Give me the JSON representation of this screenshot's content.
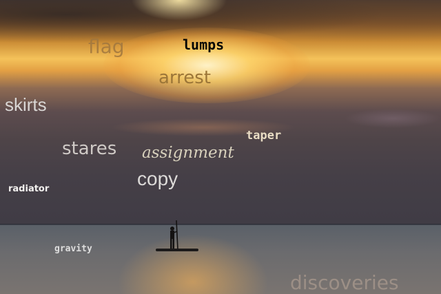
{
  "overlay_words": {
    "flag": "flag",
    "lumps": "lumps",
    "arrest": "arrest",
    "skirts": "skirts",
    "taper": "taper",
    "stares": "stares",
    "assignment": "assignment",
    "copy": "copy",
    "radiator": "radiator",
    "gravity": "gravity",
    "discoveries": "discoveries"
  }
}
